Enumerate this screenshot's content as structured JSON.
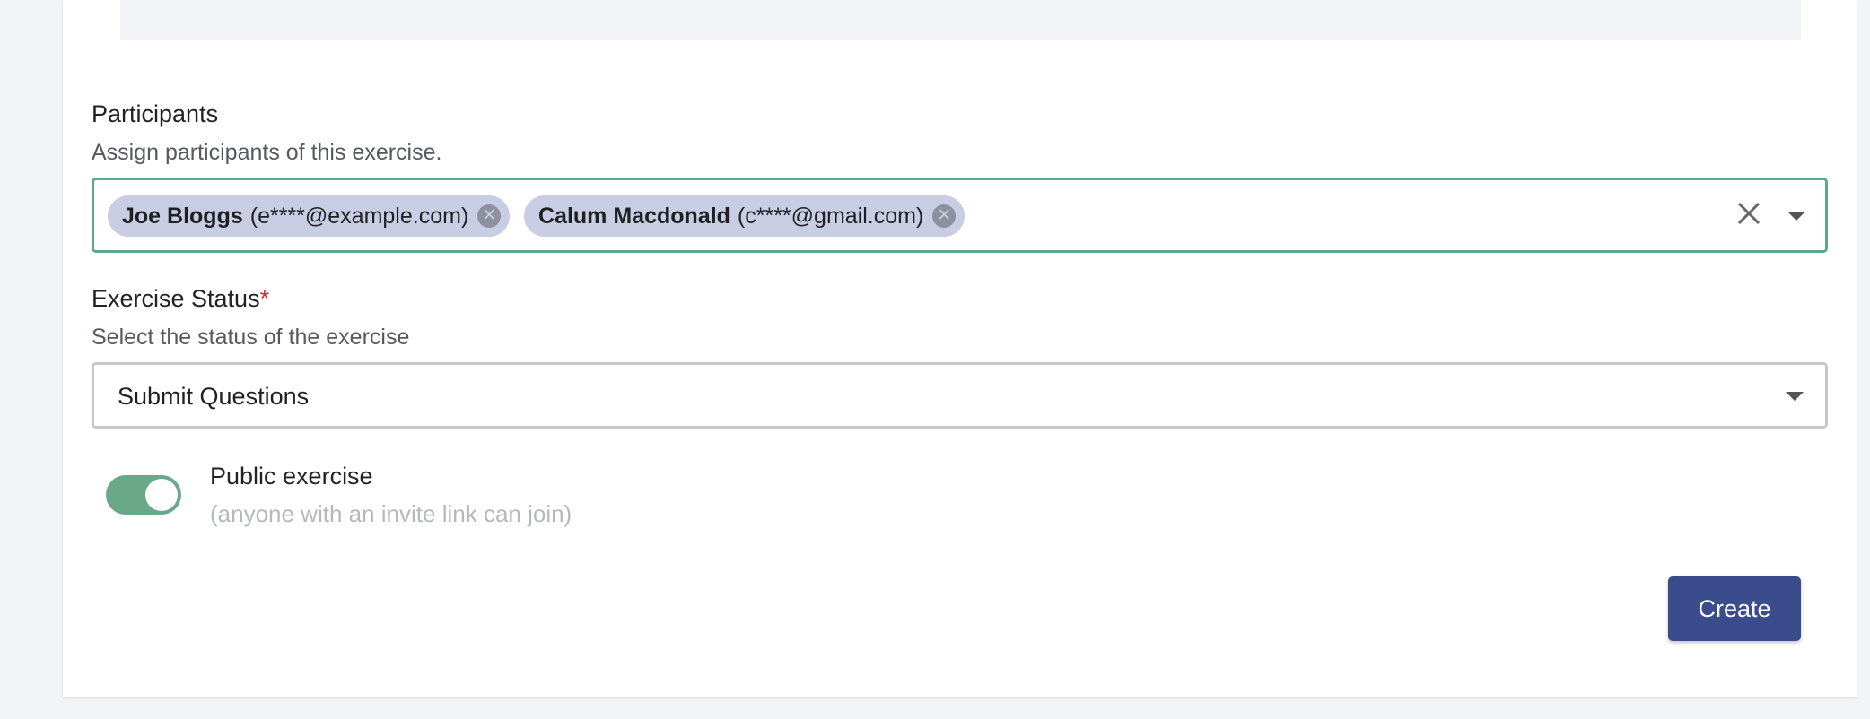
{
  "participants": {
    "label": "Participants",
    "hint": "Assign participants of this exercise.",
    "selected": [
      {
        "name": "Joe Bloggs",
        "email": "(e****@example.com)"
      },
      {
        "name": "Calum Macdonald",
        "email": "(c****@gmail.com)"
      }
    ],
    "clear_icon": "close-icon",
    "dropdown_icon": "chevron-down-icon"
  },
  "exercise_status": {
    "label": "Exercise Status",
    "required_mark": "*",
    "hint": "Select the status of the exercise",
    "value": "Submit Questions"
  },
  "public_exercise": {
    "title": "Public exercise",
    "subtitle": "(anyone with an invite link can join)",
    "enabled": true
  },
  "actions": {
    "create_label": "Create"
  },
  "colors": {
    "accent": "#3a4c8b",
    "focus_border": "#5aa98a",
    "toggle_on": "#6aa88a",
    "chip_bg": "#c9cde3",
    "required": "#d0302b"
  }
}
